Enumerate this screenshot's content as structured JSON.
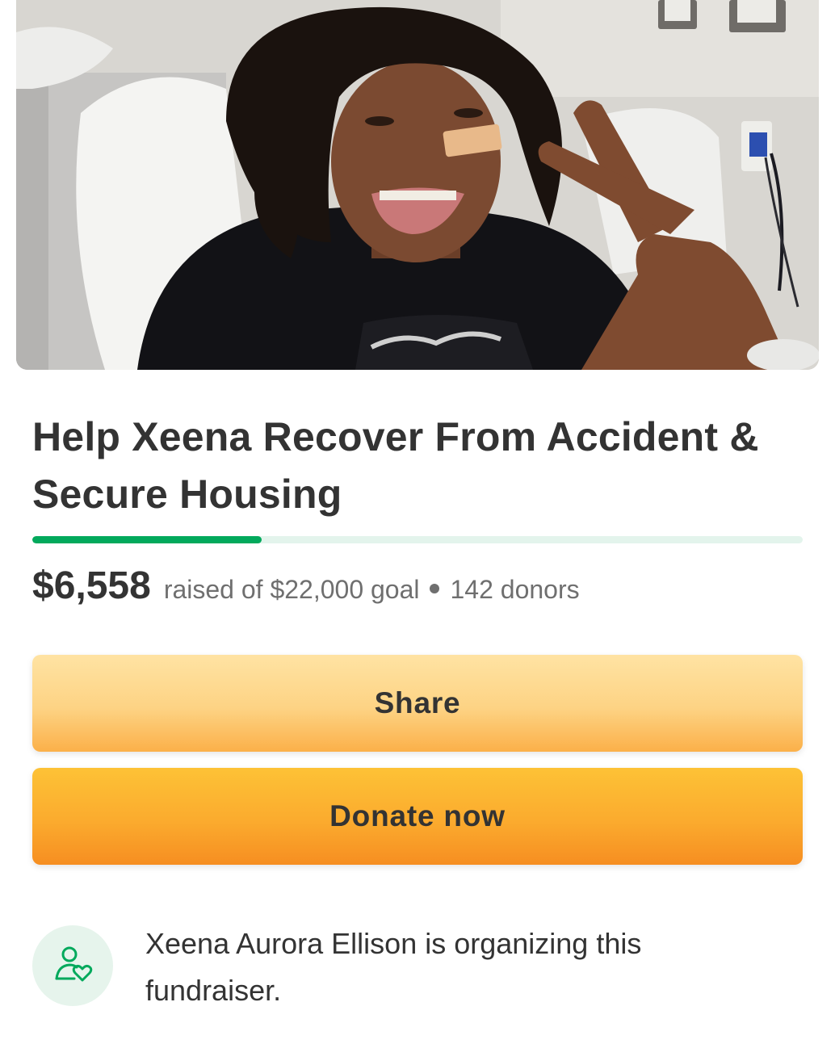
{
  "campaign": {
    "title": "Help Xeena Recover From Accident & Secure Housing",
    "raised": "$6,558",
    "goal_text": "raised of $22,000 goal",
    "donors": "142 donors",
    "progress_fraction": 0.298
  },
  "actions": {
    "share_label": "Share",
    "donate_label": "Donate now"
  },
  "organizer": {
    "text": "Xeena Aurora Ellison is organizing this fundraiser.",
    "icon": "organizer-heart-icon"
  },
  "colors": {
    "accent_green": "#02a95c",
    "track_green": "#e3f4ec",
    "share_yellow": "#fdd384",
    "donate_orange": "#fbab2e",
    "text_dark": "#333333",
    "text_muted": "#6f6f6f"
  },
  "icons": {
    "hero": "hero-photo-image",
    "organizer": "organizer-heart-icon"
  }
}
